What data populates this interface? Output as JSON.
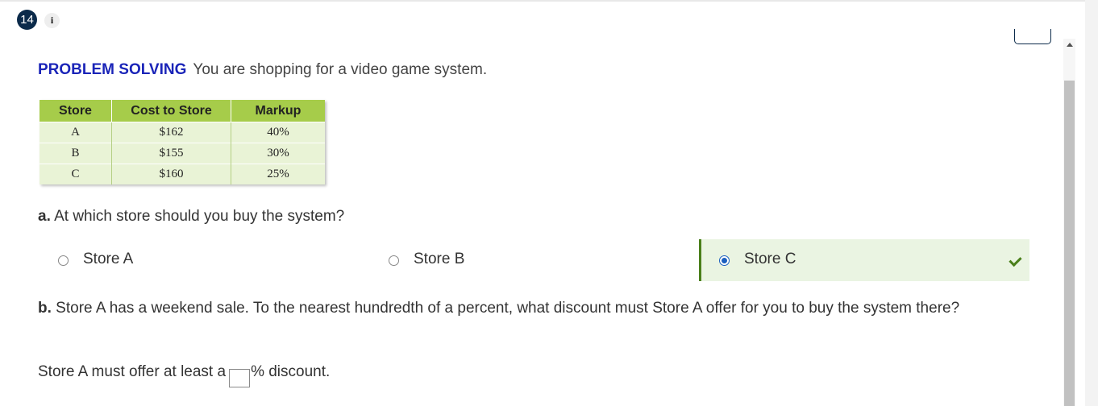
{
  "question": {
    "number": "14",
    "info_symbol": "i",
    "tag": "PROBLEM SOLVING",
    "prompt": "You are shopping for a video game system."
  },
  "table": {
    "headers": [
      "Store",
      "Cost to Store",
      "Markup"
    ],
    "rows": [
      [
        "A",
        "$162",
        "40%"
      ],
      [
        "B",
        "$155",
        "30%"
      ],
      [
        "C",
        "$160",
        "25%"
      ]
    ]
  },
  "part_a": {
    "label": "a.",
    "text": "At which store should you buy the system?",
    "options": [
      "Store A",
      "Store B",
      "Store C"
    ],
    "selected": "Store C",
    "status": "correct"
  },
  "part_b": {
    "label": "b.",
    "text": "Store A has a weekend sale. To the nearest hundredth of a percent, what discount must Store A offer for you to buy the system there?"
  },
  "answer": {
    "before": "Store A must offer at least a",
    "value": "",
    "after": "% discount."
  },
  "colors": {
    "tag_blue": "#1a24b8",
    "table_header": "#a6cc4a",
    "table_body": "#e9f3d6",
    "correct_green": "#4a7f1a",
    "correct_bg": "#eaf4e2",
    "badge_navy": "#0b2a4a"
  },
  "icons": [
    "info-icon",
    "checkmark-icon",
    "scroll-up-icon"
  ]
}
